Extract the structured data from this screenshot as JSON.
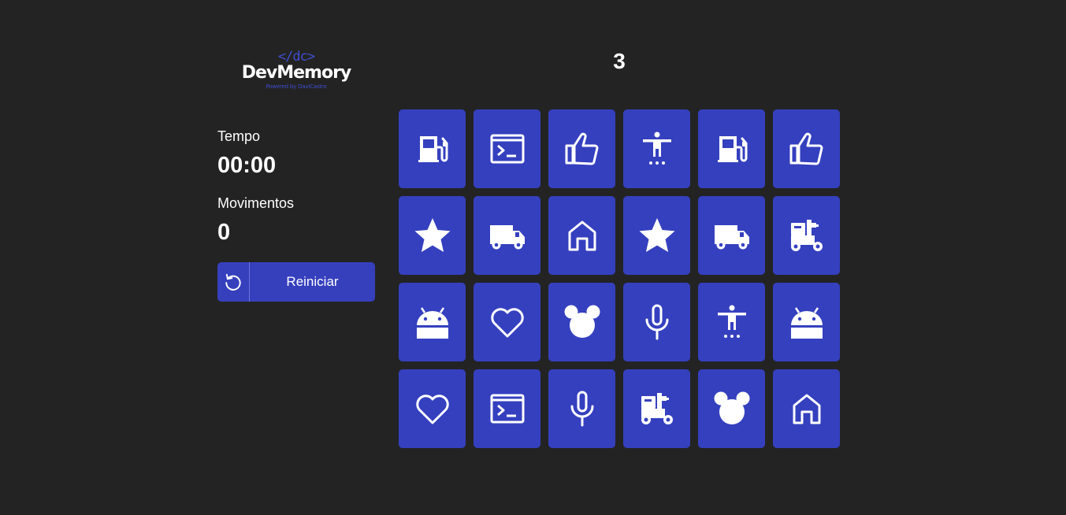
{
  "logo": {
    "mark": "</dc>",
    "name": "DevMemory",
    "powered": "Powered by DaviCastro"
  },
  "level": "3",
  "stats": {
    "time_label": "Tempo",
    "time_value": "00:00",
    "moves_label": "Movimentos",
    "moves_value": "0"
  },
  "restart_button": {
    "label": "Reiniciar",
    "icon": "restart-icon"
  },
  "colors": {
    "background": "#232323",
    "card": "#3540bf",
    "accent": "#3f4ed1"
  },
  "board": {
    "rows": 4,
    "cols": 6,
    "cards": [
      "gas-station-icon",
      "terminal-icon",
      "thumbs-up-icon",
      "accessibility-icon",
      "gas-station-icon",
      "thumbs-up-icon",
      "star-icon",
      "truck-icon",
      "home-icon",
      "star-icon",
      "truck-icon",
      "forklift-icon",
      "android-icon",
      "heart-icon",
      "mouse-ears-icon",
      "microphone-icon",
      "accessibility-icon",
      "android-icon",
      "heart-icon",
      "terminal-icon",
      "microphone-icon",
      "forklift-icon",
      "mouse-ears-icon",
      "home-icon"
    ]
  }
}
